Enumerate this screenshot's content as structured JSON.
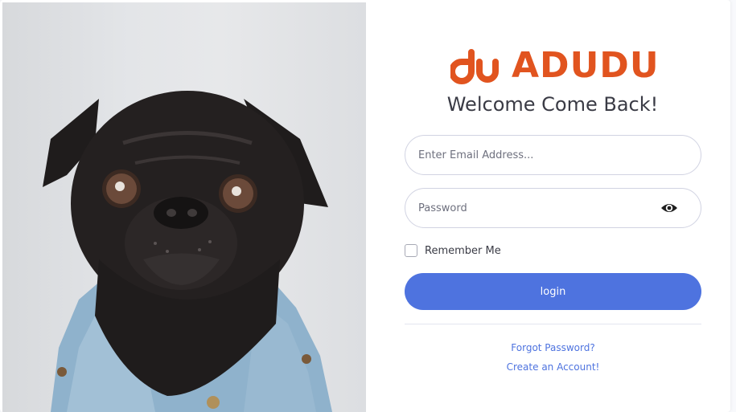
{
  "brand": {
    "name": "ADUDU",
    "logo_icon": "adudu-logo-icon",
    "color": "#e1541f"
  },
  "title": "Welcome Come Back!",
  "form": {
    "email_placeholder": "Enter Email Address...",
    "password_placeholder": "Password",
    "remember_label": "Remember Me",
    "login_label": "login"
  },
  "links": {
    "forgot": "Forgot Password?",
    "create": "Create an Account!"
  },
  "colors": {
    "primary": "#4e73df",
    "text": "#3a3b45",
    "muted": "#6e707e"
  },
  "icons": {
    "password_toggle": "eye-icon"
  },
  "image": {
    "subject": "pug-dog-photo"
  }
}
